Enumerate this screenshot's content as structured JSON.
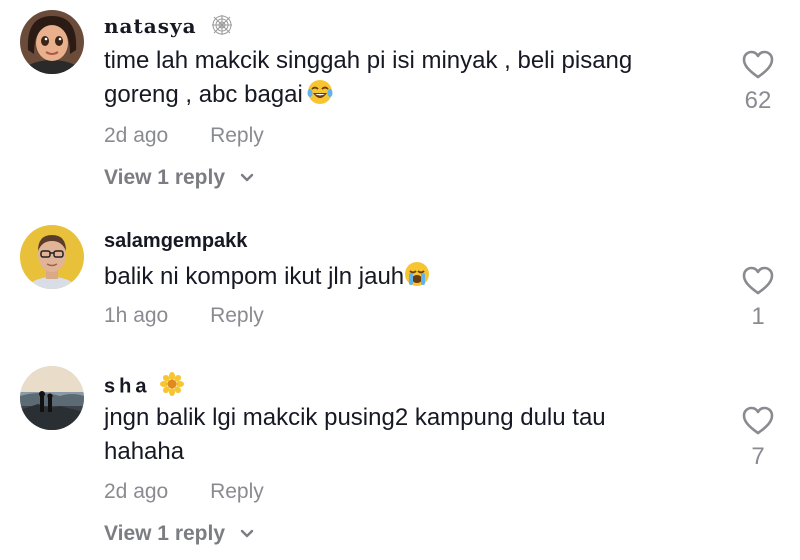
{
  "comments": [
    {
      "username": "natasya",
      "badge_icon": "spiderweb-icon",
      "text_line1": "time lah makcik singgah pi isi minyak , beli pisang",
      "text_line2": "goreng , abc bagai",
      "emoji_icon": "tears-of-joy-emoji",
      "time": "2d ago",
      "reply_label": "Reply",
      "view_replies": "View 1 reply",
      "likes": "62"
    },
    {
      "username": "salamgempakk",
      "text_line1": "balik ni kompom ikut jln jauh",
      "emoji_icon": "crying-face-emoji",
      "time": "1h ago",
      "reply_label": "Reply",
      "likes": "1"
    },
    {
      "username": "sha",
      "badge_icon": "sunflower-icon",
      "text_line1": "jngn balik lgi makcik pusing2 kampung dulu tau",
      "text_line2": "hahaha",
      "time": "2d ago",
      "reply_label": "Reply",
      "view_replies": "View 1 reply",
      "likes": "7"
    }
  ]
}
